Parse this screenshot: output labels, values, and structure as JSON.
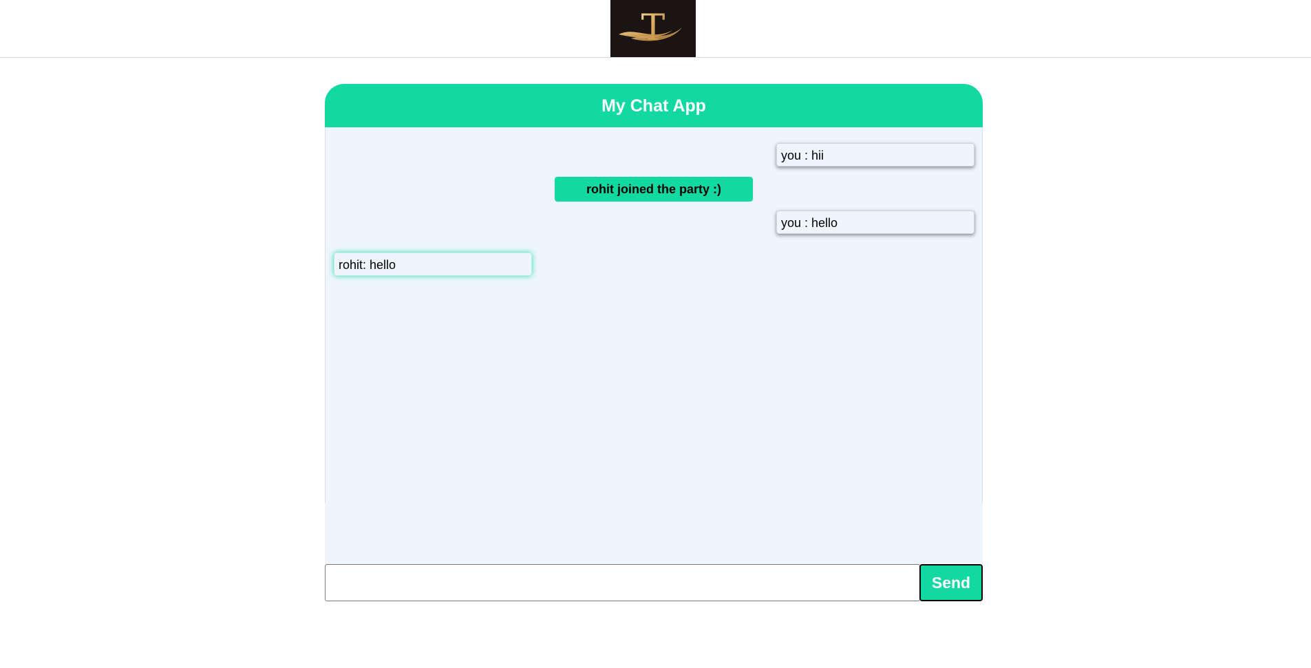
{
  "header": {
    "logo_letter": "T"
  },
  "chat": {
    "title": "My Chat App",
    "messages": [
      {
        "kind": "outgoing",
        "text": "you : hii"
      },
      {
        "kind": "notice",
        "text": "rohit joined the party :)"
      },
      {
        "kind": "outgoing",
        "text": "you : hello"
      },
      {
        "kind": "incoming",
        "text": "rohit: hello"
      }
    ]
  },
  "composer": {
    "input_value": "",
    "send_label": "Send"
  },
  "colors": {
    "accent": "#12d8a2",
    "chat_background": "#eef5fd",
    "logo_background": "#1a1412",
    "logo_gold": "#d9a75a"
  }
}
